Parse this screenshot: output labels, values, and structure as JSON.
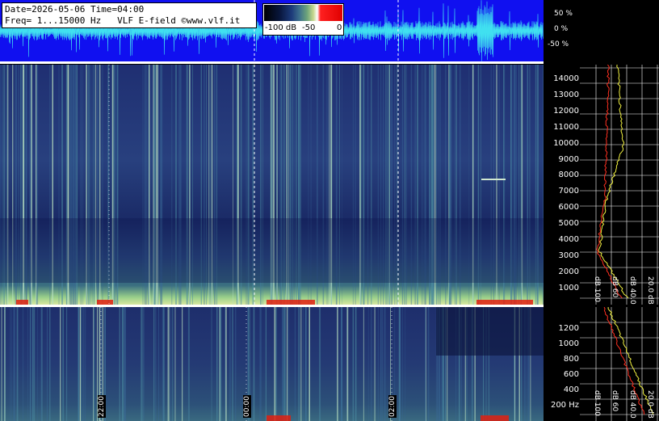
{
  "info": {
    "line1": "Date=2026-05-06 Time=04:00",
    "line2": "Freq= 1...15000 Hz   VLF E-field ©www.vlf.it"
  },
  "colorbar": {
    "min_label": "-100 dB",
    "mid_label": "-50",
    "max_label": "0"
  },
  "waveform_axis": {
    "top": "50 %",
    "mid": "0 %",
    "bottom": "-50 %"
  },
  "freq_axis_top": [
    "14000",
    "13000",
    "12000",
    "11000",
    "10000",
    "9000",
    "8000",
    "7000",
    "6000",
    "5000",
    "4000",
    "3000",
    "2000",
    "1000"
  ],
  "freq_axis_bottom": [
    "1200",
    "1000",
    "800",
    "600",
    "400",
    "200 Hz"
  ],
  "time_labels": [
    "22:00",
    "00:00",
    "02:00"
  ],
  "db_axis_top": [
    "dB 100",
    "dB 60",
    "dB 40.0",
    "20.0 dB"
  ],
  "db_axis_bottom": [
    "dB 100",
    "dB 60",
    "dB 40.0",
    "20.0 dB"
  ],
  "colors": {
    "waveform_bg": "#1010f0",
    "waveform_trace": "#40e0f0",
    "profile_red": "#ff3020",
    "profile_yellow": "#f0f040"
  }
}
